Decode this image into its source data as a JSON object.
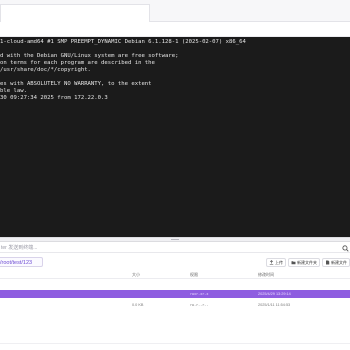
{
  "terminal": {
    "lines": [
      "1-cloud-amd64 #1 SMP PREEMPT_DYNAMIC Debian 6.1.128-1 (2025-02-07) x86_64",
      "",
      "d with the Debian GNU/Linux system are free software;",
      "on terms for each program are described in the",
      "/usr/share/doc/*/copyright.",
      "",
      "es with ABSOLUTELY NO WARRANTY, to the extent",
      "ble law.",
      "30 09:27:34 2025 from 172.22.0.3"
    ]
  },
  "command_bar": {
    "placeholder": "ter 发送到终端...",
    "search_icon": "search-icon"
  },
  "file_manager": {
    "path": "/root/test/123",
    "actions": [
      {
        "label": "上传",
        "icon": "upload-icon"
      },
      {
        "label": "新建文件夹",
        "icon": "new-folder-icon"
      },
      {
        "label": "新建文件",
        "icon": "new-file-icon"
      }
    ],
    "columns": {
      "name": "",
      "size": "大小",
      "permission": "权限",
      "modified": "修改时间"
    },
    "rows": [
      {
        "name": "",
        "size": "",
        "permission": "rwxr-xr-x",
        "modified": "2025/4/29 13:29:14",
        "selected": true
      },
      {
        "name": "",
        "size": "0.0 KB",
        "permission": "rw-r--r--",
        "modified": "2025/1/11 11:54:53",
        "selected": false
      }
    ]
  },
  "colors": {
    "terminal_bg": "#1b1b1b",
    "terminal_text": "#e6e6e6",
    "accent": "#8e5de0",
    "path_text": "#6d4bd3"
  }
}
